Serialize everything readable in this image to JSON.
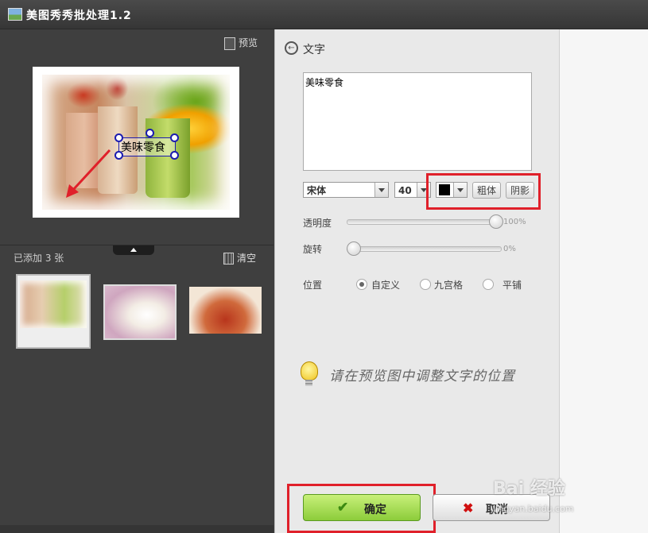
{
  "window": {
    "title": "美图秀秀批处理1.2"
  },
  "left_panel": {
    "preview_label": "预览",
    "overlay_text": "美味零食",
    "added_count_label": "已添加 3 张",
    "clear_label": "清空"
  },
  "text_panel": {
    "title": "文字",
    "text_value": "美味零食",
    "font": "宋体",
    "size": "40",
    "color": "#000000",
    "bold_label": "粗体",
    "shadow_label": "阴影",
    "opacity_label": "透明度",
    "opacity_value": "100%",
    "rotate_label": "旋转",
    "rotate_value": "0%",
    "position_label": "位置",
    "position_options": [
      {
        "label": "自定义",
        "selected": true
      },
      {
        "label": "九宫格",
        "selected": false
      },
      {
        "label": "平铺",
        "selected": false
      }
    ],
    "hint": "请在预览图中调整文字的位置",
    "ok_label": "确定",
    "cancel_label": "取消"
  },
  "colors": {
    "highlight": "#e0202a",
    "ok_green": "#8ccc3a",
    "handle_blue": "#1b1bb0"
  },
  "watermark": {
    "text": "Bai 经验",
    "url": "jingyan.baidu.com"
  }
}
